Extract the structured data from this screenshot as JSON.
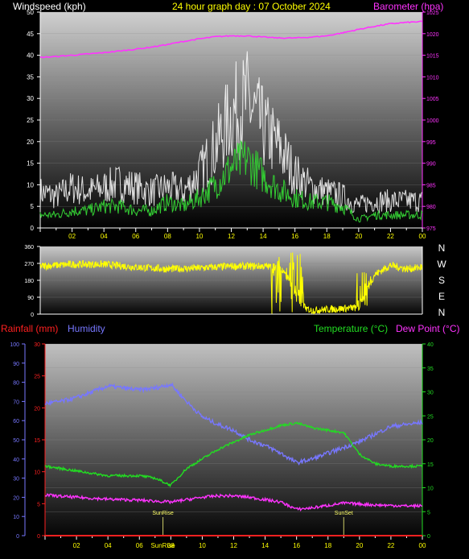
{
  "header": {
    "left_title": "Windspeed (kph)",
    "center_title": "24 hour graph day : 07 October 2024",
    "right_title": "Barometer (hpa)"
  },
  "lower_header": {
    "rainfall": "Rainfall (mm)",
    "humidity": "Humidity",
    "temperature": "Temperature (°C)",
    "dewpoint": "Dew Point (°C)"
  },
  "compass_labels": [
    "N",
    "W",
    "S",
    "E",
    "N"
  ],
  "colors": {
    "wind": "#ffffff",
    "gust": "#ffffff",
    "avgwind": "#33cc33",
    "barometer": "#ff33ff",
    "direction": "#ffff00",
    "temperature": "#22dd22",
    "humidity": "#7777ff",
    "dewpoint": "#ff33ff",
    "rainfall": "#ff2020",
    "time_labels": "#ffff00"
  },
  "chart_data": [
    {
      "type": "line",
      "id": "wind",
      "x_ticks": [
        "02",
        "04",
        "06",
        "08",
        "10",
        "12",
        "14",
        "16",
        "18",
        "20",
        "22",
        "00"
      ],
      "y_left": {
        "label": "Windspeed (kph)",
        "ticks": [
          0,
          5,
          10,
          15,
          20,
          25,
          30,
          35,
          40,
          45,
          50
        ],
        "range": [
          0,
          50
        ]
      },
      "y_right": {
        "label": "Barometer (hpa)",
        "ticks": [
          975,
          980,
          985,
          990,
          995,
          1000,
          1005,
          1010,
          1015,
          1020,
          1025
        ],
        "range": [
          975,
          1025
        ]
      },
      "x_hours": [
        0,
        1,
        2,
        3,
        4,
        5,
        6,
        7,
        8,
        9,
        10,
        11,
        12,
        13,
        14,
        15,
        16,
        17,
        18,
        19,
        20,
        21,
        22,
        23,
        24
      ],
      "series": [
        {
          "name": "gust",
          "values": [
            8,
            7,
            9,
            8,
            9,
            10,
            9,
            8,
            9,
            8,
            12,
            18,
            25,
            28,
            22,
            18,
            12,
            9,
            8,
            7,
            5,
            6,
            6,
            6,
            6
          ]
        },
        {
          "name": "average",
          "values": [
            3,
            3,
            4,
            4,
            5,
            5,
            4,
            4,
            6,
            5,
            7,
            10,
            14,
            16,
            12,
            9,
            7,
            6,
            6,
            5,
            2,
            3,
            3,
            3,
            3
          ]
        },
        {
          "name": "barometer",
          "values": [
            1014.5,
            1014.7,
            1015.0,
            1015.3,
            1015.6,
            1016.0,
            1016.4,
            1016.9,
            1017.5,
            1018.2,
            1018.8,
            1019.3,
            1019.5,
            1019.5,
            1019.2,
            1019.0,
            1019.0,
            1019.2,
            1019.5,
            1020.2,
            1021.0,
            1021.7,
            1022.3,
            1022.6,
            1022.8
          ]
        }
      ]
    },
    {
      "type": "line",
      "id": "direction",
      "y_ticks": [
        0,
        90,
        180,
        270,
        360
      ],
      "range": [
        0,
        360
      ],
      "x_hours": [
        0,
        2,
        4,
        6,
        8,
        10,
        12,
        14,
        15,
        15.5,
        16,
        16.5,
        17,
        18,
        19,
        20,
        21,
        22,
        23,
        24
      ],
      "series": [
        {
          "name": "direction",
          "values": [
            255,
            265,
            265,
            250,
            240,
            245,
            255,
            255,
            250,
            200,
            120,
            40,
            20,
            25,
            30,
            35,
            210,
            260,
            240,
            250
          ]
        }
      ]
    },
    {
      "type": "line",
      "id": "temp_hum",
      "x_ticks": [
        "02",
        "04",
        "06",
        "08",
        "10",
        "12",
        "14",
        "16",
        "18",
        "20",
        "22",
        "00"
      ],
      "y_far_left": {
        "label": "Humidity",
        "ticks": [
          0,
          10,
          20,
          30,
          40,
          50,
          60,
          70,
          80,
          90,
          100
        ],
        "range": [
          0,
          100
        ]
      },
      "y_left": {
        "label": "Rainfall (mm)",
        "ticks": [
          0,
          5,
          10,
          15,
          20,
          25,
          30
        ],
        "range": [
          0,
          30
        ]
      },
      "y_right": {
        "label": "Temperature (°C)",
        "ticks": [
          0,
          5,
          10,
          15,
          20,
          25,
          30,
          35,
          40
        ],
        "range": [
          0,
          40
        ]
      },
      "x_hours": [
        0,
        1,
        2,
        3,
        4,
        5,
        6,
        7,
        8,
        9,
        10,
        11,
        12,
        13,
        14,
        15,
        16,
        17,
        18,
        19,
        20,
        21,
        22,
        23,
        24
      ],
      "series": [
        {
          "name": "Humidity",
          "values": [
            69,
            70,
            72,
            75,
            78,
            77,
            76,
            77,
            79,
            70,
            62,
            58,
            55,
            50,
            47,
            43,
            38,
            40,
            43,
            46,
            49,
            53,
            57,
            58,
            59
          ]
        },
        {
          "name": "Temperature",
          "values": [
            14.5,
            14,
            13.5,
            13,
            12.5,
            12.5,
            12.5,
            12,
            10.5,
            14,
            16,
            18,
            19.5,
            21,
            22,
            23,
            23.5,
            22.5,
            22,
            21.5,
            17,
            15,
            14.5,
            14.5,
            14.5
          ]
        },
        {
          "name": "Dew Point",
          "values": [
            8.5,
            8.2,
            8,
            7.8,
            7.6,
            7.5,
            7.4,
            7.2,
            7,
            7.5,
            8,
            8.3,
            8.3,
            8,
            7.5,
            7,
            5.5,
            5.8,
            6.3,
            6.8,
            6.6,
            6.4,
            6.3,
            6.2,
            6.2
          ]
        },
        {
          "name": "Rainfall",
          "values": [
            0,
            0,
            0,
            0,
            0,
            0,
            0,
            0,
            0,
            0,
            0,
            0,
            0,
            0,
            0,
            0,
            0,
            0,
            0,
            0,
            0,
            0,
            0,
            0,
            0
          ]
        }
      ],
      "annotations": [
        "SunRise",
        "SunSet"
      ]
    }
  ]
}
